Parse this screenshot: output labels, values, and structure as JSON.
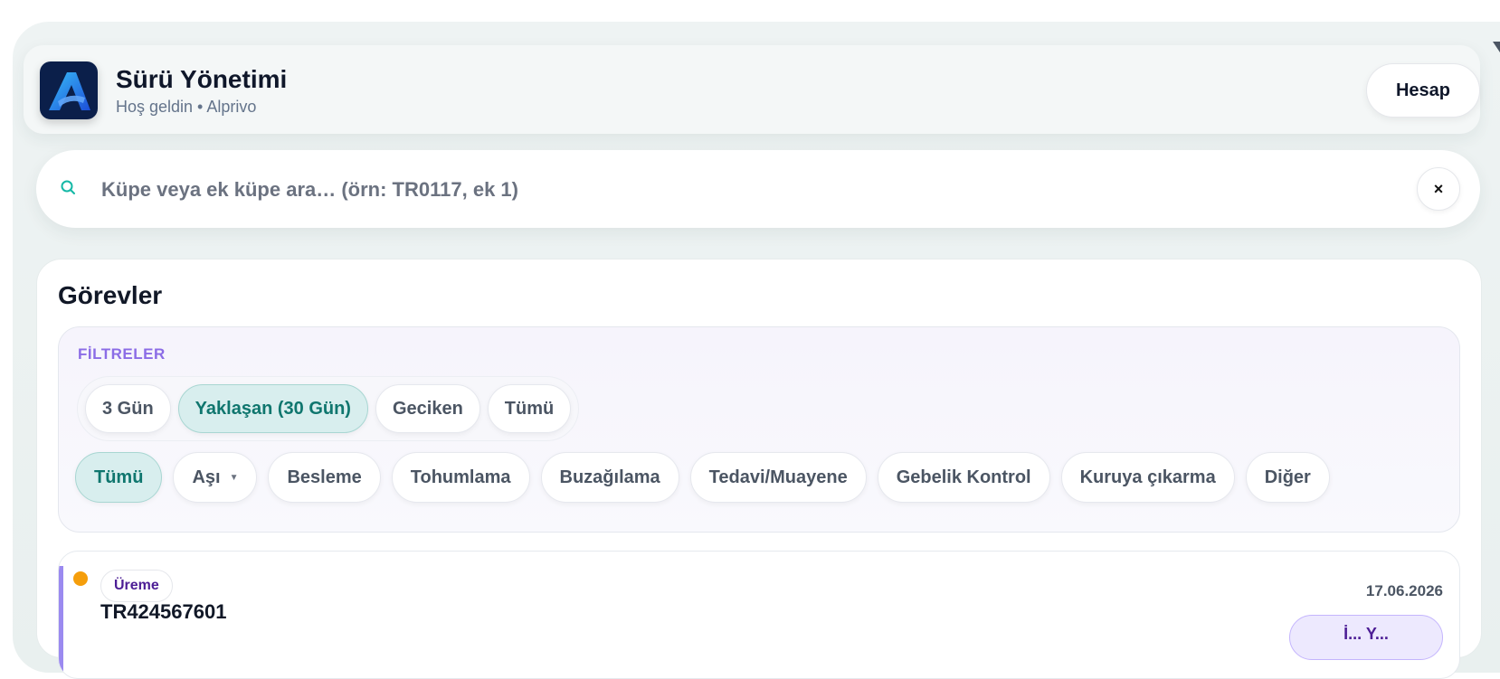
{
  "header": {
    "title": "Sürü Yönetimi",
    "subtitle": "Hoş geldin • Alprivo",
    "account_label": "Hesap"
  },
  "search": {
    "placeholder": "Küpe veya ek küpe ara… (örn: TR0117, ek 1)",
    "value": "",
    "clear_label": "×"
  },
  "tasks": {
    "title": "Görevler",
    "filters_label": "FİLTRELER",
    "periods": [
      {
        "label": "3 Gün",
        "active": false
      },
      {
        "label": "Yaklaşan (30 Gün)",
        "active": true
      },
      {
        "label": "Geciken",
        "active": false
      },
      {
        "label": "Tümü",
        "active": false
      }
    ],
    "types": [
      {
        "label": "Tümü",
        "active": true
      },
      {
        "label": "Aşı",
        "active": false
      },
      {
        "label": "Besleme",
        "active": false
      },
      {
        "label": "Tohumlama",
        "active": false
      },
      {
        "label": "Buzağılama",
        "active": false
      },
      {
        "label": "Tedavi/Muayene",
        "active": false
      },
      {
        "label": "Gebelik Kontrol",
        "active": false
      },
      {
        "label": "Kuruya çıkarma",
        "active": false
      },
      {
        "label": "Diğer",
        "active": false
      }
    ],
    "items": [
      {
        "category": "Üreme",
        "tag": "TR424567601",
        "date": "17.06.2026",
        "action": "İ... Y...",
        "status_color": "#f59e0b"
      }
    ]
  },
  "colors": {
    "accent_teal": "#0f766e",
    "accent_purple": "#8b6ce6",
    "logo_bg": "#0b1f4a"
  },
  "icons": {
    "search": "search-icon",
    "clear": "close-icon",
    "logo": "app-logo-icon",
    "dropdown": "chevron-down-icon"
  }
}
